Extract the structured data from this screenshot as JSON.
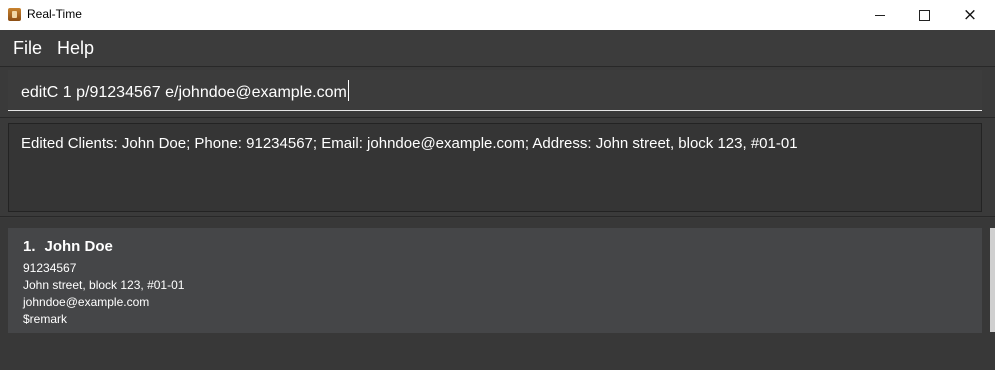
{
  "window": {
    "title": "Real-Time",
    "icon": "app-icon",
    "controls": {
      "minimize": "minimize-icon",
      "maximize": "maximize-icon",
      "close": "×"
    }
  },
  "menu": {
    "items": [
      "File",
      "Help"
    ]
  },
  "command": {
    "value": "editC 1 p/91234567 e/johndoe@example.com"
  },
  "result": {
    "message": "Edited Clients: John Doe; Phone: 91234567; Email: johndoe@example.com; Address: John street, block 123, #01-01"
  },
  "persons": [
    {
      "index": "1.",
      "name": "John Doe",
      "phone": "91234567",
      "address": "John street, block 123, #01-01",
      "email": "johndoe@example.com",
      "remark": "$remark"
    }
  ],
  "colors": {
    "background": "#3a3a3a",
    "card": "#454648",
    "text": "#ffffff",
    "titlebar": "#ffffff"
  }
}
